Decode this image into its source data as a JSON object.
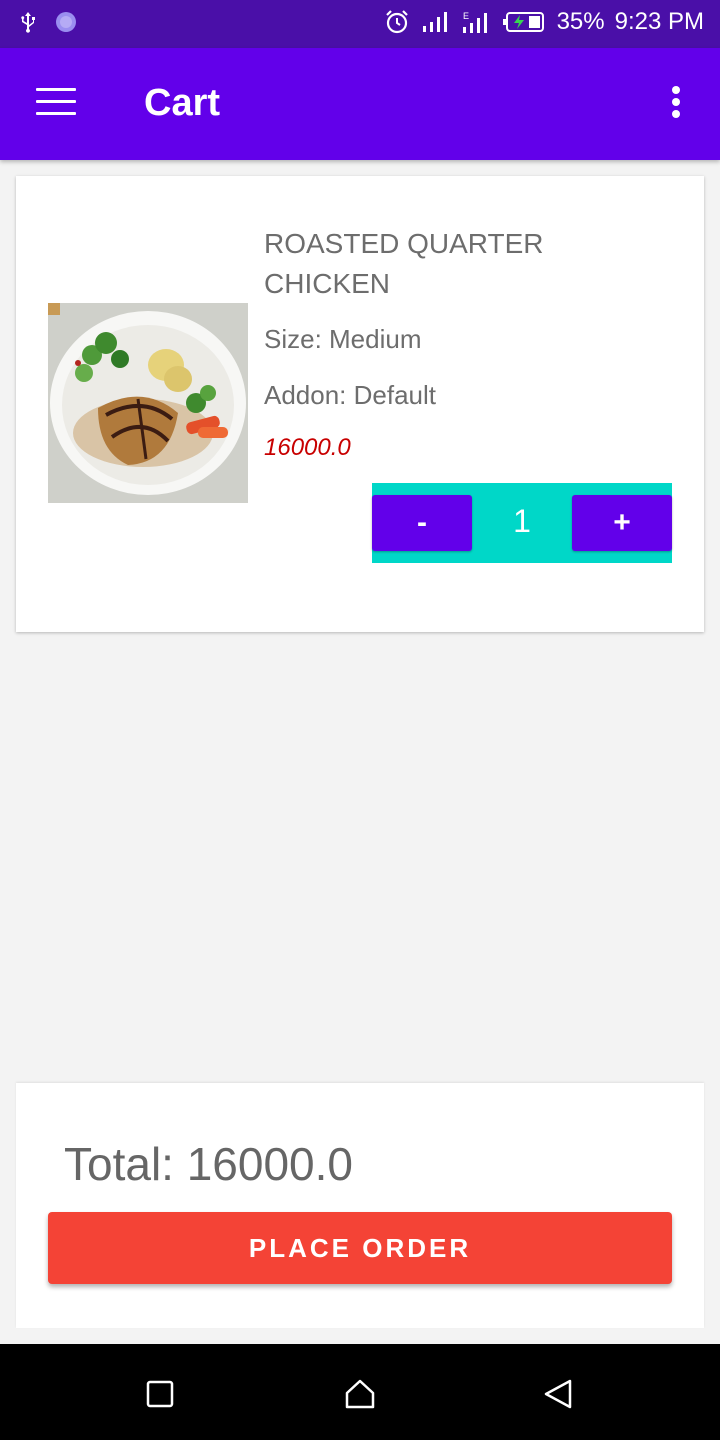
{
  "status_bar": {
    "battery": "35%",
    "time": "9:23 PM",
    "icons": [
      "usb-icon",
      "app-notification-icon",
      "alarm-icon",
      "signal-icon",
      "signal-e-icon",
      "battery-charging-icon"
    ]
  },
  "app_bar": {
    "title": "Cart",
    "menu_icon": "hamburger-menu-icon",
    "more_icon": "more-vert-icon"
  },
  "cart_item": {
    "name": "ROASTED QUARTER CHICKEN",
    "size": "Size: Medium",
    "addon": "Addon: Default",
    "price": "16000.0",
    "quantity": "1",
    "minus_label": "-",
    "plus_label": "+"
  },
  "summary": {
    "total": "Total: 16000.0",
    "place_order_label": "PLACE ORDER"
  },
  "nav_bar": {
    "buttons": [
      "recents-square-icon",
      "home-icon",
      "back-triangle-icon"
    ]
  },
  "colors": {
    "status_bar": "#4a0fa8",
    "app_bar": "#6200ea",
    "stepper_bg": "#00d7c8",
    "stepper_btn": "#6200ea",
    "price": "#c80000",
    "place_order": "#f44336"
  }
}
